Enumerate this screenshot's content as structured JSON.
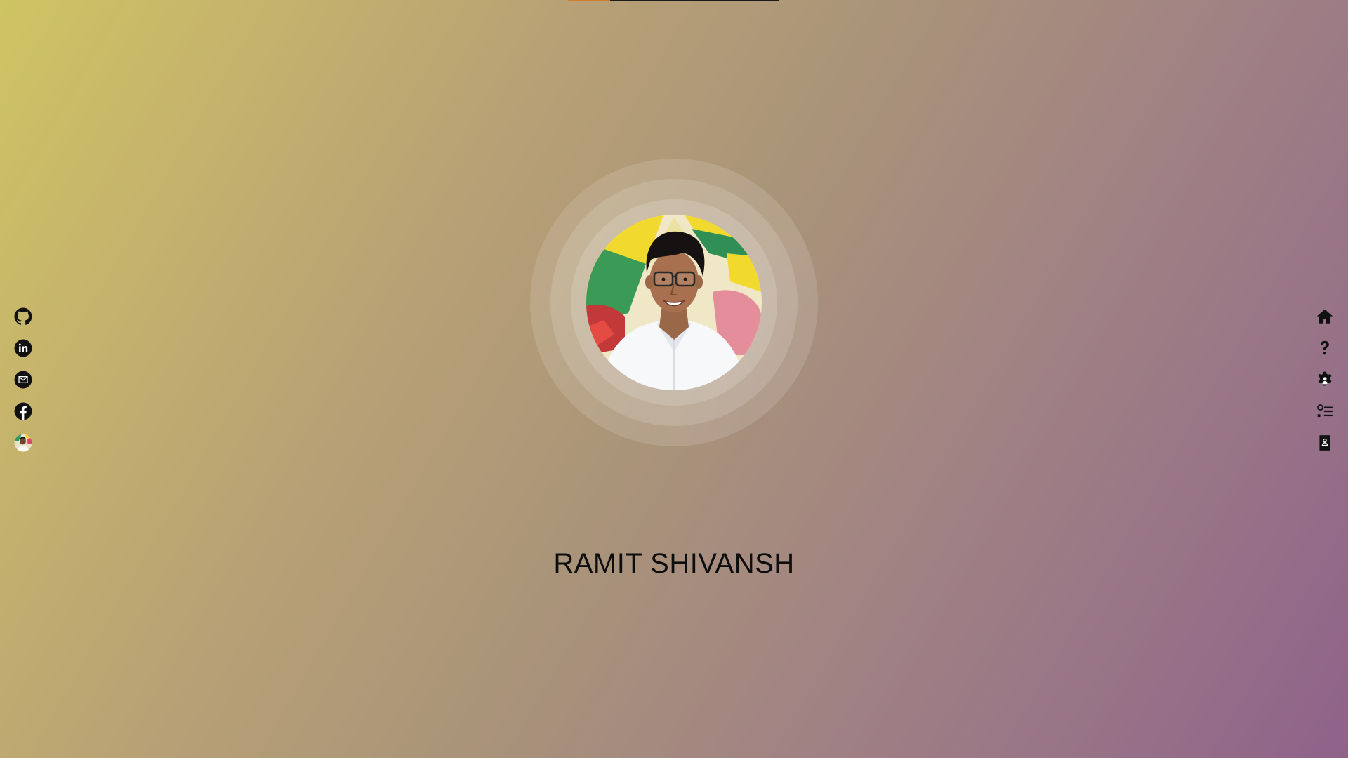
{
  "loading_bar": {
    "progress": 0.2,
    "color": "#d07d28"
  },
  "profile": {
    "name": "RAMIT SHIVANSH",
    "avatar_icon": "profile-photo"
  },
  "social_links": [
    {
      "icon": "github-icon"
    },
    {
      "icon": "linkedin-icon"
    },
    {
      "icon": "email-icon"
    },
    {
      "icon": "facebook-icon"
    },
    {
      "icon": "avatar-icon"
    }
  ],
  "nav_links": [
    {
      "icon": "home-icon"
    },
    {
      "icon": "question-icon"
    },
    {
      "icon": "gear-icon"
    },
    {
      "icon": "checklist-icon"
    },
    {
      "icon": "contact-card-icon"
    }
  ],
  "colors": {
    "gradient_start": "#cfc463",
    "gradient_end": "#8f628a",
    "text": "#0d0d0d"
  }
}
